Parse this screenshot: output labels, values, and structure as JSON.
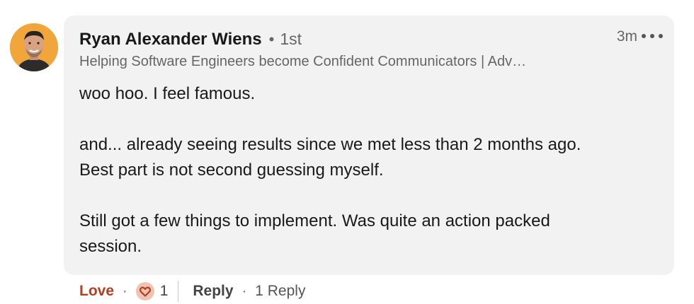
{
  "comment": {
    "author_name": "Ryan Alexander Wiens",
    "separator": "•",
    "connection_degree": "1st",
    "headline": "Helping Software Engineers become Confident Communicators | Adv…",
    "timestamp": "3m",
    "body_paragraphs": [
      [
        "woo hoo. I feel famous."
      ],
      [
        "and... already seeing results since we met less than 2 months ago.",
        "Best part is not second guessing myself."
      ],
      [
        "Still got a few things to implement. Was quite an action packed",
        "session."
      ]
    ]
  },
  "actions": {
    "reaction_label": "Love",
    "dot": "·",
    "reaction_icon": "heart-icon",
    "reaction_count": "1",
    "reply_label": "Reply",
    "replies_count_label": "1 Reply"
  },
  "colors": {
    "bubble_bg": "#f2f2f2",
    "love_accent": "#b24020",
    "avatar_bg": "#f0a63b"
  }
}
